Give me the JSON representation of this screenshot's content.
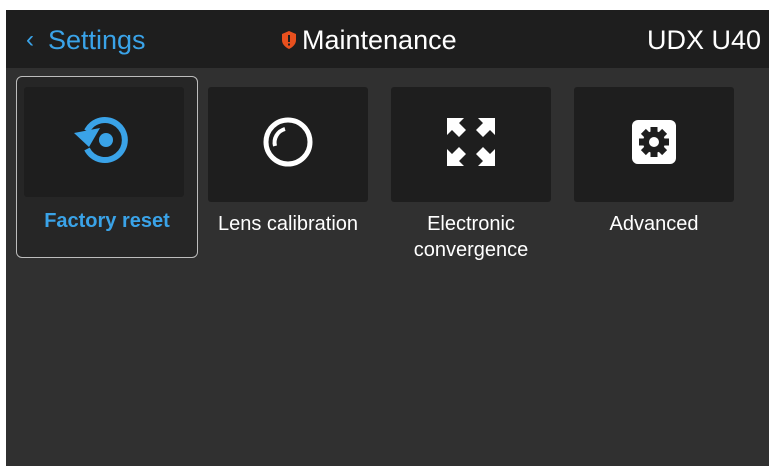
{
  "header": {
    "back_label": "Settings",
    "title": "Maintenance",
    "model": "UDX U40"
  },
  "tiles": [
    {
      "label": "Factory reset",
      "icon": "factory-reset-icon",
      "selected": true
    },
    {
      "label": "Lens calibration",
      "icon": "lens-icon",
      "selected": false
    },
    {
      "label_line1": "Electronic",
      "label_line2": "convergence",
      "icon": "convergence-icon",
      "selected": false
    },
    {
      "label": "Advanced",
      "icon": "gear-icon",
      "selected": false
    }
  ],
  "colors": {
    "accent": "#3aa3e8",
    "warning": "#e8501e",
    "header_bg": "#1e1e1e",
    "body_bg": "#303030"
  }
}
